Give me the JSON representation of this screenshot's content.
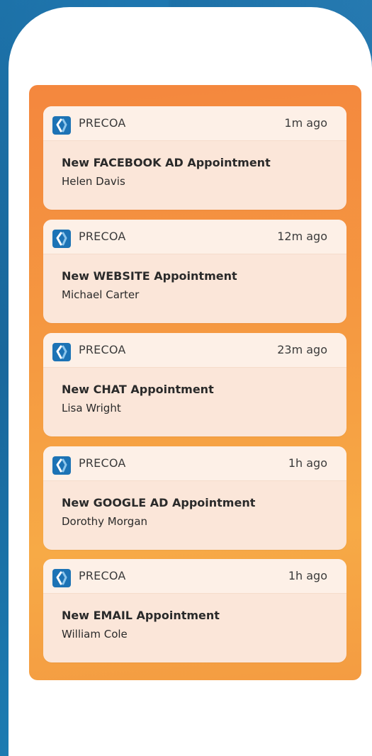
{
  "colors": {
    "background": "#1f79b3",
    "panel": "#f59a41",
    "card": "#fbe6d9",
    "card_header": "#fdf0e7",
    "logo": "#1c73b5"
  },
  "notifications": [
    {
      "app": "PRECOA",
      "time": "1m ago",
      "title": "New FACEBOOK AD Appointment",
      "name": "Helen Davis",
      "icon": "precoa-logo-icon"
    },
    {
      "app": "PRECOA",
      "time": "12m ago",
      "title": "New WEBSITE Appointment",
      "name": "Michael Carter",
      "icon": "precoa-logo-icon"
    },
    {
      "app": "PRECOA",
      "time": "23m ago",
      "title": "New CHAT Appointment",
      "name": "Lisa Wright",
      "icon": "precoa-logo-icon"
    },
    {
      "app": "PRECOA",
      "time": "1h ago",
      "title": "New GOOGLE AD Appointment",
      "name": "Dorothy Morgan",
      "icon": "precoa-logo-icon"
    },
    {
      "app": "PRECOA",
      "time": "1h ago",
      "title": "New EMAIL Appointment",
      "name": "William Cole",
      "icon": "precoa-logo-icon"
    }
  ]
}
